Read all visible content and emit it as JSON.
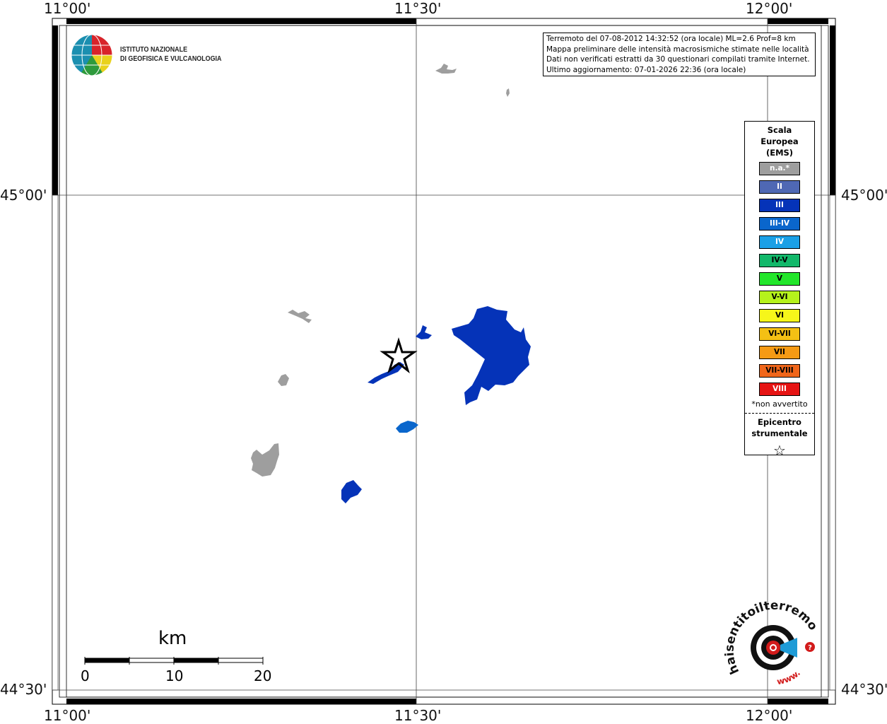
{
  "map": {
    "lon_labels": [
      "11°00'",
      "11°30'",
      "12°00'"
    ],
    "lat_labels": [
      "45°00'",
      "44°30'"
    ]
  },
  "info": {
    "line1": "Terremoto del 07-08-2012 14:32:52 (ora locale) ML=2.6 Prof=8 km",
    "line2": "Mappa preliminare delle intensità macrosismiche stimate nelle località",
    "line3": "Dati non verificati estratti da 30 questionari compilati tramite Internet.",
    "line4": "Ultimo aggiornamento: 07-01-2026 22:36 (ora locale)"
  },
  "logo": {
    "line1": "ISTITUTO NAZIONALE",
    "line2": "DI GEOFISICA E VULCANOLOGIA"
  },
  "legend": {
    "title_line1": "Scala",
    "title_line2": "Europea",
    "title_line3": "(EMS)",
    "items": [
      {
        "label": "n.a.*",
        "color": "#9e9e9e",
        "text_color": "#ffffff"
      },
      {
        "label": "II",
        "color": "#4f68b4",
        "text_color": "#ffffff"
      },
      {
        "label": "III",
        "color": "#0533b8",
        "text_color": "#ffffff"
      },
      {
        "label": "III-IV",
        "color": "#0a66cc",
        "text_color": "#ffffff"
      },
      {
        "label": "IV",
        "color": "#1aa0e6",
        "text_color": "#ffffff"
      },
      {
        "label": "IV-V",
        "color": "#12b86a",
        "text_color": "#000000"
      },
      {
        "label": "V",
        "color": "#22e62a",
        "text_color": "#000000"
      },
      {
        "label": "V-VI",
        "color": "#b5f21c",
        "text_color": "#000000"
      },
      {
        "label": "VI",
        "color": "#f6f61a",
        "text_color": "#000000"
      },
      {
        "label": "VI-VII",
        "color": "#f4c014",
        "text_color": "#000000"
      },
      {
        "label": "VII",
        "color": "#f59a14",
        "text_color": "#000000"
      },
      {
        "label": "VII-VIII",
        "color": "#f0661a",
        "text_color": "#000000"
      },
      {
        "label": "VIII",
        "color": "#e61414",
        "text_color": "#ffffff"
      }
    ],
    "note": "*non avvertito",
    "epicenter_line1": "Epicentro",
    "epicenter_line2": "strumentale"
  },
  "scale": {
    "unit": "km",
    "ticks": [
      "0",
      "10",
      "20"
    ]
  },
  "watermark": {
    "text_main": "haisentitoilterremoto.it",
    "text_www": "www."
  }
}
